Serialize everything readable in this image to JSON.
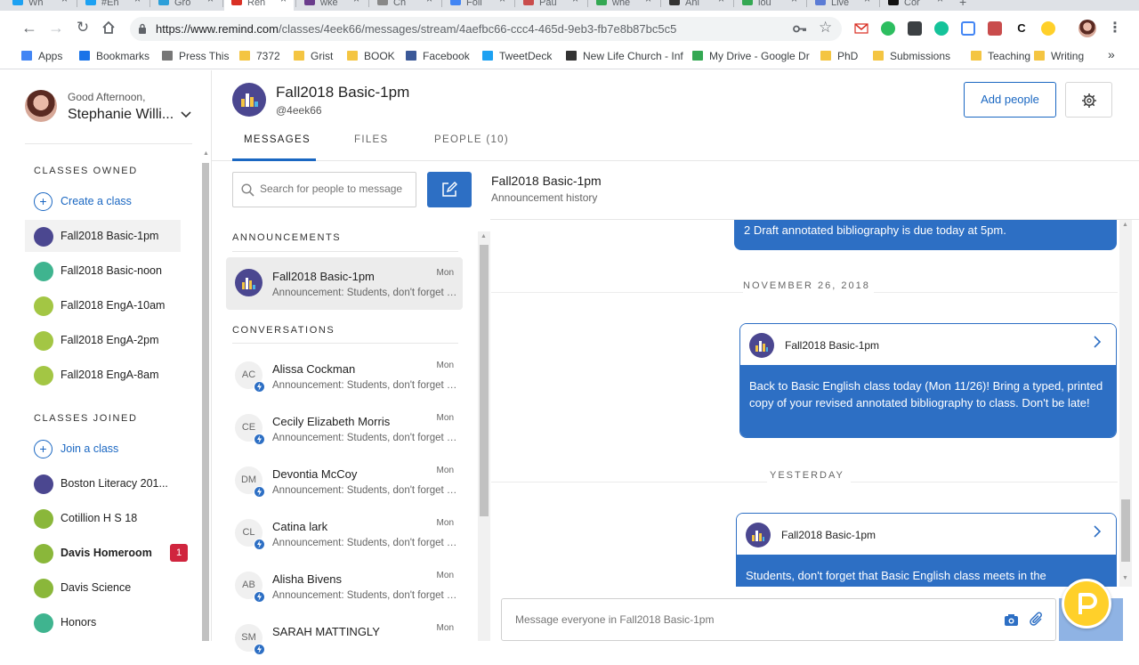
{
  "browser": {
    "tabs": [
      {
        "label": "Wh",
        "color": "#1da1f2"
      },
      {
        "label": "#En",
        "color": "#1da1f2"
      },
      {
        "label": "Gro",
        "color": "#2d9fd9"
      },
      {
        "label": "Ren",
        "color": "#d93025"
      },
      {
        "label": "wke",
        "color": "#6a3c8c"
      },
      {
        "label": "Ch",
        "color": "#888888"
      },
      {
        "label": "Foll",
        "color": "#4285f4"
      },
      {
        "label": "Pau",
        "color": "#c94c4c"
      },
      {
        "label": "whe",
        "color": "#34a853"
      },
      {
        "label": "Ani",
        "color": "#333333"
      },
      {
        "label": "lou",
        "color": "#34a853"
      },
      {
        "label": "Live",
        "color": "#5b7bd5"
      },
      {
        "label": "Cor",
        "color": "#111111"
      }
    ],
    "url_host": "https://www.remind.com",
    "url_path": "/classes/4eek66/messages/stream/4aefbc66-ccc4-465d-9eb3-fb7e8b87bc5c5",
    "bookmarks": [
      {
        "label": "Apps",
        "icon": "apps-grid-icon",
        "color": "#4285f4"
      },
      {
        "label": "Bookmarks",
        "icon": "star-icon",
        "color": "#1a73e8"
      },
      {
        "label": "Press This",
        "icon": "page-icon",
        "color": "#777777"
      },
      {
        "label": "7372",
        "icon": "folder-icon",
        "color": "#f4c542"
      },
      {
        "label": "Grist",
        "icon": "folder-icon",
        "color": "#f4c542"
      },
      {
        "label": "BOOK",
        "icon": "folder-icon",
        "color": "#f4c542"
      },
      {
        "label": "Facebook",
        "icon": "facebook-icon",
        "color": "#3b5998"
      },
      {
        "label": "TweetDeck",
        "icon": "tweetdeck-icon",
        "color": "#1da1f2"
      },
      {
        "label": "New Life Church - Inf",
        "icon": "f1-icon",
        "color": "#333333"
      },
      {
        "label": "My Drive - Google Dr",
        "icon": "drive-icon",
        "color": "#34a853"
      },
      {
        "label": "PhD",
        "icon": "folder-icon",
        "color": "#f4c542"
      },
      {
        "label": "Submissions",
        "icon": "folder-icon",
        "color": "#f4c542"
      },
      {
        "label": "Teaching",
        "icon": "folder-icon",
        "color": "#f4c542"
      },
      {
        "label": "Writing",
        "icon": "folder-icon",
        "color": "#f4c542"
      }
    ],
    "bookmarks_overflow": "»"
  },
  "sidebar": {
    "greeting": "Good Afternoon,",
    "user_name": "Stephanie Willi...",
    "owned_heading": "CLASSES OWNED",
    "create_label": "Create a class",
    "owned": [
      {
        "label": "Fall2018 Basic-1pm",
        "color": "#4b4790"
      },
      {
        "label": "Fall2018 Basic-noon",
        "color": "#3fb48f"
      },
      {
        "label": "Fall2018 EngA-10am",
        "color": "#a3c644"
      },
      {
        "label": "Fall2018 EngA-2pm",
        "color": "#a3c644"
      },
      {
        "label": "Fall2018 EngA-8am",
        "color": "#a3c644"
      }
    ],
    "joined_heading": "CLASSES JOINED",
    "join_label": "Join a class",
    "joined": [
      {
        "label": "Boston Literacy 201...",
        "color": "#4b4790"
      },
      {
        "label": "Cotillion H S 18",
        "color": "#8ab73a"
      },
      {
        "label": "Davis Homeroom",
        "color": "#8ab73a",
        "badge": "1"
      },
      {
        "label": "Davis Science",
        "color": "#8ab73a"
      },
      {
        "label": "Honors",
        "color": "#3fb48f"
      }
    ]
  },
  "header": {
    "class_name": "Fall2018 Basic-1pm",
    "class_code": "@4eek66",
    "add_people": "Add people",
    "tabs": [
      "MESSAGES",
      "FILES",
      "PEOPLE (10)"
    ]
  },
  "list": {
    "search_placeholder": "Search for people to message",
    "announcements_heading": "ANNOUNCEMENTS",
    "conversations_heading": "CONVERSATIONS",
    "announcement": {
      "name": "Fall2018 Basic-1pm",
      "preview": "Announcement: Students, don't forget that Basic English class meets",
      "time": "Mon"
    },
    "conversations": [
      {
        "initials": "AC",
        "name": "Alissa Cockman",
        "preview": "Announcement: Students, don't forget that Basic English class meets",
        "time": "Mon"
      },
      {
        "initials": "CE",
        "name": "Cecily Elizabeth Morris",
        "preview": "Announcement: Students, don't forget that Basic English class meets",
        "time": "Mon"
      },
      {
        "initials": "DM",
        "name": "Devontia McCoy",
        "preview": "Announcement: Students, don't forget that Basic English class meets",
        "time": "Mon"
      },
      {
        "initials": "CL",
        "name": "Catina lark",
        "preview": "Announcement: Students, don't forget that Basic English class meets",
        "time": "Mon"
      },
      {
        "initials": "AB",
        "name": "Alisha Bivens",
        "preview": "Announcement: Students, don't forget that Basic English class meets",
        "time": "Mon"
      },
      {
        "initials": "SM",
        "name": "SARAH MATTINGLY",
        "preview": "",
        "time": "Mon"
      }
    ]
  },
  "messages": {
    "title": "Fall2018 Basic-1pm",
    "subtitle": "Announcement history",
    "prev_fragment": "2 Draft annotated bibliography is due today at 5pm.",
    "date1": "NOVEMBER 26, 2018",
    "msg1_sender": "Fall2018 Basic-1pm",
    "msg1_body": "Back to Basic English class today (Mon 11/26)! Bring a typed, printed copy of your revised annotated bibliography to class. Don't be late!",
    "date2": "YESTERDAY",
    "msg2_sender": "Fall2018 Basic-1pm",
    "msg2_body": "Students, don't forget that Basic English class meets in the",
    "composer_placeholder": "Message everyone in Fall2018 Basic-1pm"
  },
  "colors": {
    "accent": "#2d6fc4",
    "class_purple": "#4b4790",
    "fab_yellow": "#ffd02a",
    "badge_red": "#d0253e"
  }
}
